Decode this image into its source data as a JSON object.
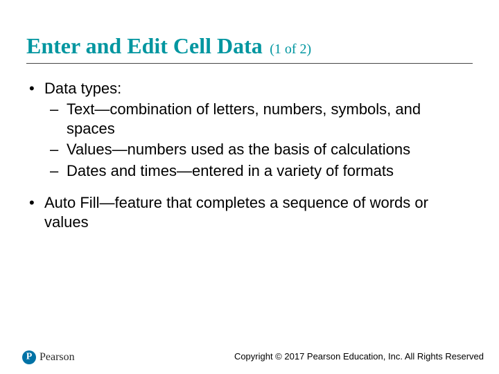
{
  "title": "Enter and Edit Cell Data",
  "title_suffix": "(1 of 2)",
  "bullets": [
    {
      "text": "Data types:",
      "sub": [
        "Text—combination of letters, numbers, symbols, and spaces",
        "Values—numbers used as the basis of calculations",
        "Dates and times—entered in a variety of formats"
      ]
    },
    {
      "text": "Auto Fill—feature that completes a sequence of words or values",
      "sub": []
    }
  ],
  "brand": "Pearson",
  "copyright": "Copyright © 2017 Pearson Education, Inc. All Rights Reserved"
}
